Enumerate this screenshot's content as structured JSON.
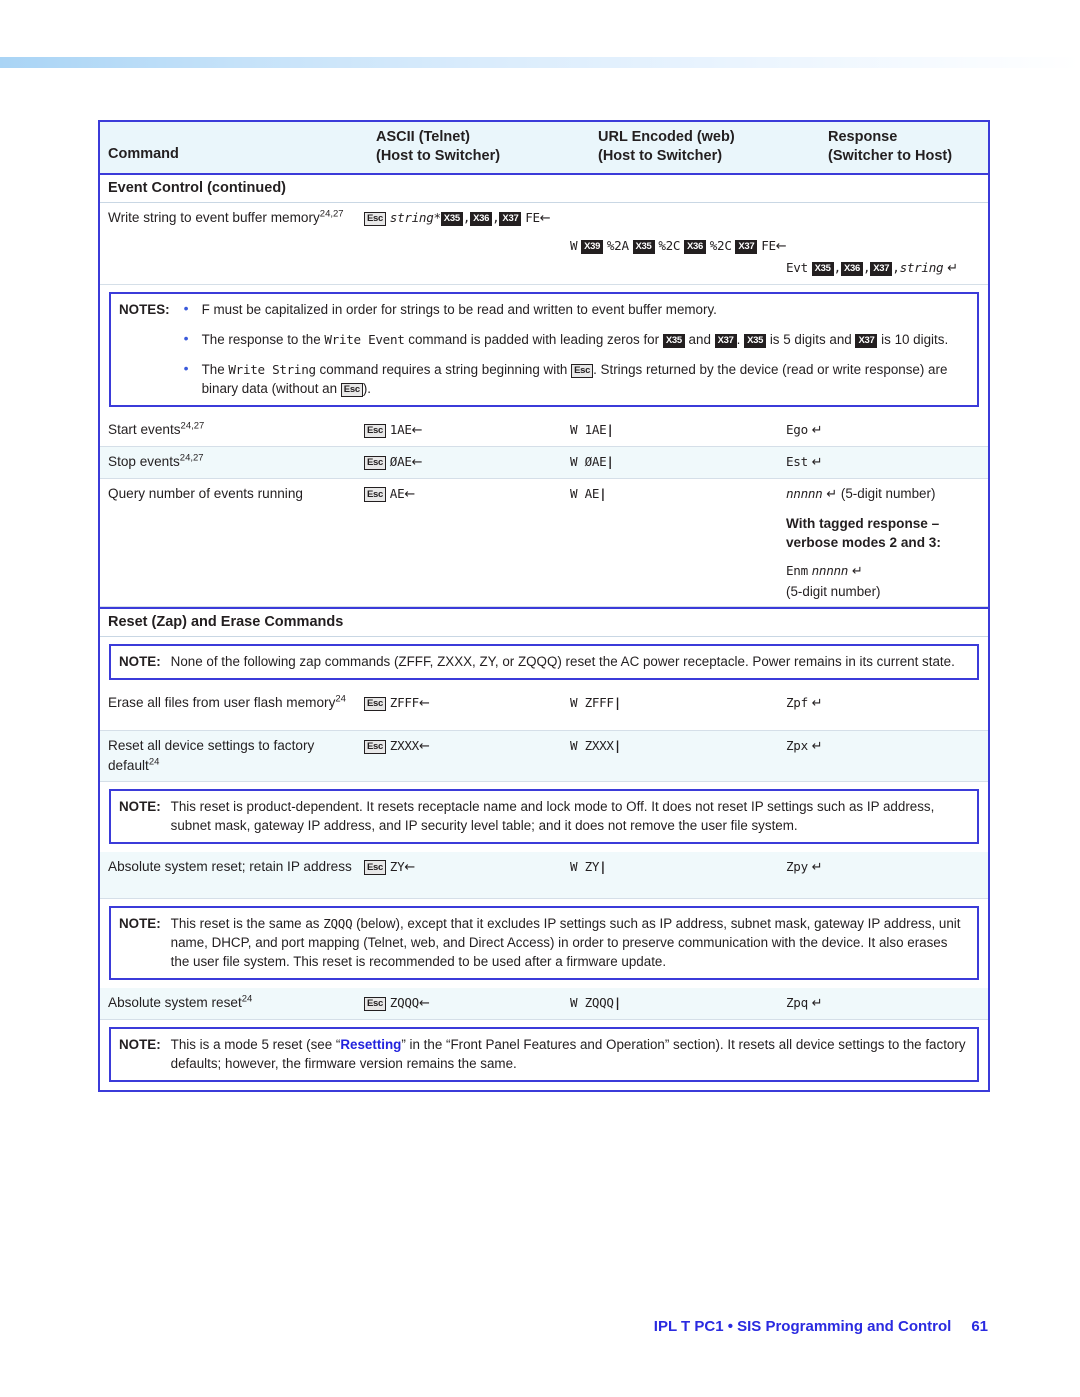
{
  "document": {
    "footer_title": "IPL T PC1 • SIS Programming and Control",
    "page_number": "61"
  },
  "table": {
    "headers": {
      "command": "Command",
      "ascii_line1": "ASCII (Telnet)",
      "ascii_line2": "(Host to Switcher)",
      "url_line1": "URL Encoded (web)",
      "url_line2": "(Host to Switcher)",
      "response_line1": "Response",
      "response_line2": "(Switcher to Host)"
    },
    "sections": [
      {
        "title": "Event Control (continued)"
      },
      {
        "title": "Reset (Zap) and Erase Commands"
      }
    ],
    "rows": {
      "write_string": {
        "command_text": "Write string to event buffer memory",
        "command_sup": "24,27",
        "ascii": {
          "esc": "Esc",
          "string": "string",
          "star": "*",
          "v1": "X35",
          "comma1": ",",
          "v2": "X36",
          "comma2": ",",
          "v3": "X37",
          "tail": "FE",
          "arrow": "←"
        },
        "url": {
          "w": "W",
          "v0": "X39",
          "e1": "%2A",
          "v1": "X35",
          "e2": "%2C",
          "v2": "X36",
          "e3": "%2C",
          "v3": "X37",
          "tail": "FE",
          "arrow": "←"
        },
        "response": {
          "evt": "Evt",
          "v1": "X35",
          "comma1": ",",
          "v2": "X36",
          "comma2": ",",
          "v3": "X37",
          "comma3": ",",
          "string": "string",
          "cr": "↵"
        }
      },
      "start_events": {
        "command_text": "Start events",
        "command_sup": "24,27",
        "ascii": {
          "esc": "Esc",
          "body": "1AE",
          "arrow": "←"
        },
        "url": "W 1AE",
        "url_pipe": "|",
        "response": "Ego",
        "response_cr": "↵"
      },
      "stop_events": {
        "command_text": "Stop events",
        "command_sup": "24,27",
        "ascii": {
          "esc": "Esc",
          "body": "ØAE",
          "arrow": "←"
        },
        "url": "W ØAE",
        "url_pipe": "|",
        "response": "Est",
        "response_cr": "↵"
      },
      "query_events": {
        "command_text": "Query number of events running",
        "command_sup": "",
        "ascii": {
          "esc": "Esc",
          "body": "AE",
          "arrow": "←"
        },
        "url": "W AE",
        "url_pipe": "|",
        "response_var": "nnnnn",
        "response_cr": "↵",
        "response_note": "(5-digit number)",
        "tagged_line1": "With tagged response –",
        "tagged_line2": "verbose modes 2 and 3:",
        "tagged_prefix": "Enm",
        "tagged_var": "nnnnn",
        "tagged_cr": "↵",
        "tagged_note": "(5-digit number)"
      },
      "erase_flash": {
        "command_text": "Erase all files from user flash memory",
        "command_sup": "24",
        "ascii": {
          "esc": "Esc",
          "body": "ZFFF",
          "arrow": "←"
        },
        "url": "W ZFFF",
        "url_pipe": "|",
        "response": "Zpf",
        "response_cr": "↵"
      },
      "reset_factory": {
        "command_text": "Reset all device settings to factory default",
        "command_sup": "24",
        "ascii": {
          "esc": "Esc",
          "body": "ZXXX",
          "arrow": "←"
        },
        "url": "W ZXXX",
        "url_pipe": "|",
        "response": "Zpx",
        "response_cr": "↵"
      },
      "absolute_retain_ip": {
        "command_text": "Absolute system reset; retain IP address",
        "command_sup": "",
        "ascii": {
          "esc": "Esc",
          "body": "ZY",
          "arrow": "←"
        },
        "url": "W ZY",
        "url_pipe": "|",
        "response": "Zpy",
        "response_cr": "↵"
      },
      "absolute_reset": {
        "command_text": "Absolute system reset",
        "command_sup": "24",
        "ascii": {
          "esc": "Esc",
          "body": "ZQQQ",
          "arrow": "←"
        },
        "url": "W ZQQQ",
        "url_pipe": "|",
        "response": "Zpq",
        "response_cr": "↵"
      }
    }
  },
  "notes": {
    "notes_label": "NOTES:",
    "note_label": "NOTE:",
    "event_notes": {
      "bullet1": "F must be capitalized in order for strings to be read and written to event buffer memory.",
      "bullet2_a": "The response to the ",
      "bullet2_cmd": "Write Event",
      "bullet2_b": " command is padded with leading zeros for ",
      "bullet2_v1": "X35",
      "bullet2_c": " and ",
      "bullet2_v2": "X37",
      "bullet2_d": ". ",
      "bullet2_v3": "X35",
      "bullet2_e": " is 5 digits and ",
      "bullet2_v4": "X37",
      "bullet2_f": " is 10 digits.",
      "bullet3_a": "The ",
      "bullet3_cmd": "Write String",
      "bullet3_b": " command requires a string beginning with ",
      "bullet3_esc1": "Esc",
      "bullet3_c": ". Strings returned by the device (read or write response) are binary data (without an ",
      "bullet3_esc2": "Esc",
      "bullet3_d": ")."
    },
    "zap_note": "None of the following zap commands (ZFFF, ZXXX, ZY, or ZQQQ) reset the AC power receptacle. Power remains in its current state.",
    "zxxx_note": "This reset is product-dependent. It resets receptacle name and lock mode to Off. It does not reset IP settings such as IP address, subnet mask, gateway IP address, and IP security level table; and it does not remove the user file system.",
    "zy_note_a": "This reset is the same as ",
    "zy_note_cmd": "ZQQQ",
    "zy_note_b": " (below), except that it excludes IP settings such as IP address, subnet mask, gateway IP address, unit name, DHCP, and port mapping (Telnet, web, and Direct Access) in order to preserve communication with the device. It also erases the user file system. This reset is recommended to be used after a firmware update.",
    "zqqq_note_a": "This is a mode 5 reset (see “",
    "zqqq_note_link": "Resetting",
    "zqqq_note_b": "” in the “Front Panel Features and Operation” section). It resets all device settings to the factory defaults; however, the firmware version remains the same."
  },
  "colors": {
    "border_blue": "#3b3bd9",
    "header_bg": "#eaf6fb",
    "alt_row_bg": "#f0f9fb",
    "link_blue": "#2222dd",
    "footer_blue": "#2a2ae0"
  }
}
